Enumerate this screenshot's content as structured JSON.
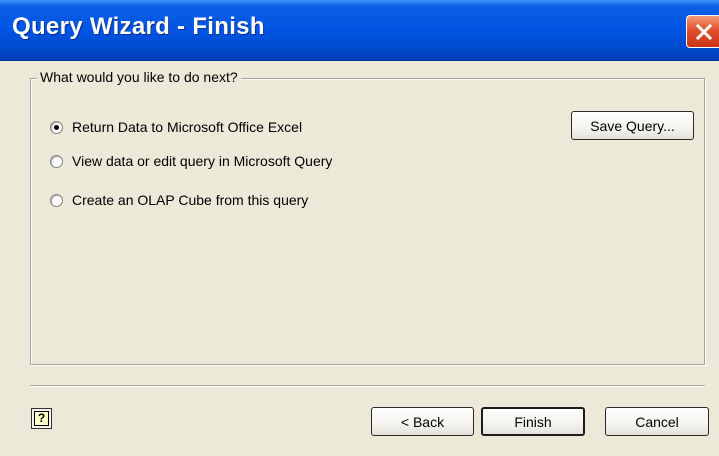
{
  "window": {
    "title": "Query Wizard - Finish"
  },
  "group": {
    "label": "What would you like to do next?"
  },
  "options": [
    {
      "label": "Return Data to Microsoft Office Excel",
      "checked": true
    },
    {
      "label": "View data or edit query in Microsoft Query",
      "checked": false
    },
    {
      "label": "Create an OLAP Cube from this query",
      "checked": false
    }
  ],
  "buttons": {
    "save_query": "Save Query...",
    "back": "< Back",
    "finish": "Finish",
    "cancel": "Cancel",
    "help_glyph": "?"
  },
  "icons": {
    "close": "close-icon",
    "help": "help-icon"
  },
  "colors": {
    "titlebar": "#0054e3",
    "close": "#e2512c",
    "face": "#ece9d8"
  }
}
